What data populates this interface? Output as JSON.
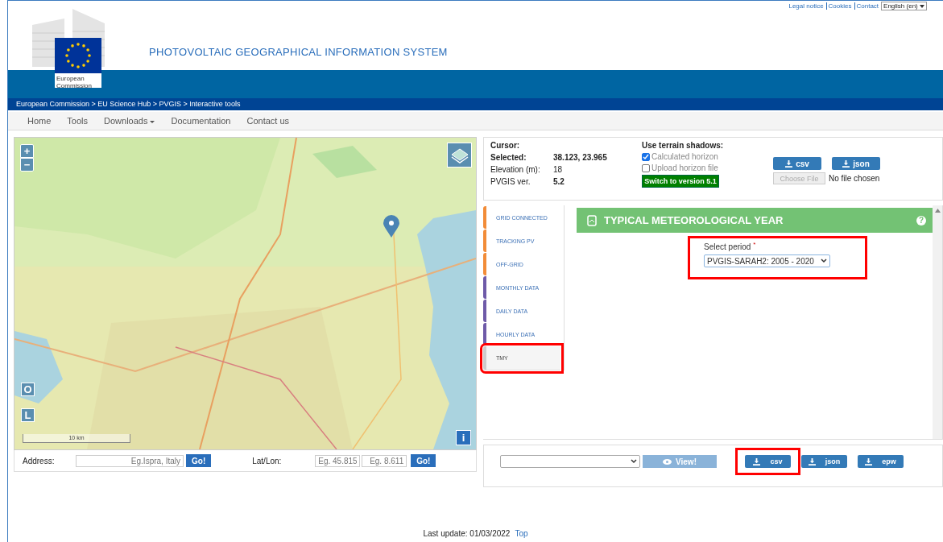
{
  "top_links": [
    "Legal notice",
    "Cookies",
    "Contact"
  ],
  "language": "English (en)",
  "logo": {
    "caption": "European Commission"
  },
  "site_title": "PHOTOVOLTAIC GEOGRAPHICAL INFORMATION SYSTEM",
  "breadcrumb": "European Commission > EU Science Hub > PVGIS > Interactive tools",
  "nav": [
    {
      "label": "Home",
      "dropdown": false
    },
    {
      "label": "Tools",
      "dropdown": false
    },
    {
      "label": "Downloads",
      "dropdown": true
    },
    {
      "label": "Documentation",
      "dropdown": false
    },
    {
      "label": "Contact us",
      "dropdown": false
    }
  ],
  "map": {
    "zoom_in": "+",
    "zoom_out": "−",
    "controls": [
      "O",
      "L"
    ],
    "info": "i",
    "scale": "10 km"
  },
  "address": {
    "label": "Address:",
    "placeholder": "Eg.Ispra, Italy",
    "button": "Go!"
  },
  "latlon": {
    "label": "Lat/Lon:",
    "lat_placeholder": "Eg. 45.815",
    "lon_placeholder": "Eg. 8.611",
    "button": "Go!"
  },
  "info": {
    "cursor_label": "Cursor:",
    "rows": [
      {
        "label": "Selected:",
        "value": "38.123, 23.965",
        "bold": true
      },
      {
        "label": "Elevation (m):",
        "value": "18",
        "bold": false
      },
      {
        "label": "PVGIS ver.",
        "value": "5.2",
        "bold": false
      }
    ],
    "shadows_title": "Use terrain shadows:",
    "options": [
      {
        "label": "Calculated horizon",
        "checked": true
      },
      {
        "label": "Upload horizon file",
        "checked": false
      }
    ],
    "switch_button": "Switch to version 5.1",
    "downloads": [
      "csv",
      "json"
    ],
    "file_button": "Choose File",
    "file_status": "No file chosen"
  },
  "tabs": [
    {
      "label": "GRID CONNECTED",
      "color": "#f28c38",
      "selected": false,
      "highlighted": false
    },
    {
      "label": "TRACKING PV",
      "color": "#f28c38",
      "selected": false,
      "highlighted": false
    },
    {
      "label": "OFF-GRID",
      "color": "#f28c38",
      "selected": false,
      "highlighted": false
    },
    {
      "label": "MONTHLY DATA",
      "color": "#6e5aa8",
      "selected": false,
      "highlighted": false
    },
    {
      "label": "DAILY DATA",
      "color": "#6e5aa8",
      "selected": false,
      "highlighted": false
    },
    {
      "label": "HOURLY DATA",
      "color": "#6e5aa8",
      "selected": false,
      "highlighted": false
    },
    {
      "label": "TMY",
      "color": "#cccccc",
      "selected": true,
      "highlighted": true
    }
  ],
  "panel": {
    "title": "TYPICAL METEOROLOGICAL YEAR",
    "help": "?",
    "period_label": "Select period",
    "required_mark": "*",
    "period_value": "PVGIS-SARAH2: 2005 - 2020",
    "highlighted": true
  },
  "output": {
    "view_button": "View!",
    "downloads": [
      {
        "label": "csv",
        "highlighted": true
      },
      {
        "label": "json",
        "highlighted": false
      },
      {
        "label": "epw",
        "highlighted": false
      }
    ]
  },
  "footer": {
    "text": "Last update: 01/03/2022",
    "link": "Top"
  }
}
